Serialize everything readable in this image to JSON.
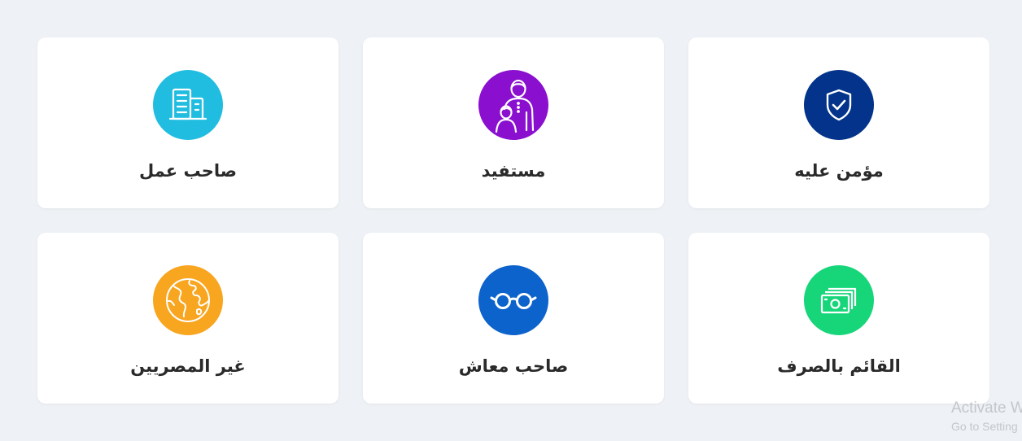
{
  "cards": [
    {
      "label": "مؤمن عليه",
      "icon": "shield-check-icon",
      "color": "#03338a"
    },
    {
      "label": "مستفيد",
      "icon": "parent-child-icon",
      "color": "#8a0fcf"
    },
    {
      "label": "صاحب عمل",
      "icon": "buildings-icon",
      "color": "#21bde0"
    },
    {
      "label": "القائم بالصرف",
      "icon": "money-bills-icon",
      "color": "#17d67a"
    },
    {
      "label": "صاحب معاش",
      "icon": "eyeglasses-icon",
      "color": "#0d63cc"
    },
    {
      "label": "غير المصريين",
      "icon": "globe-icon",
      "color": "#f8a51f"
    }
  ],
  "watermark": {
    "line1": "Activate W",
    "line2": "Go to Setting"
  }
}
